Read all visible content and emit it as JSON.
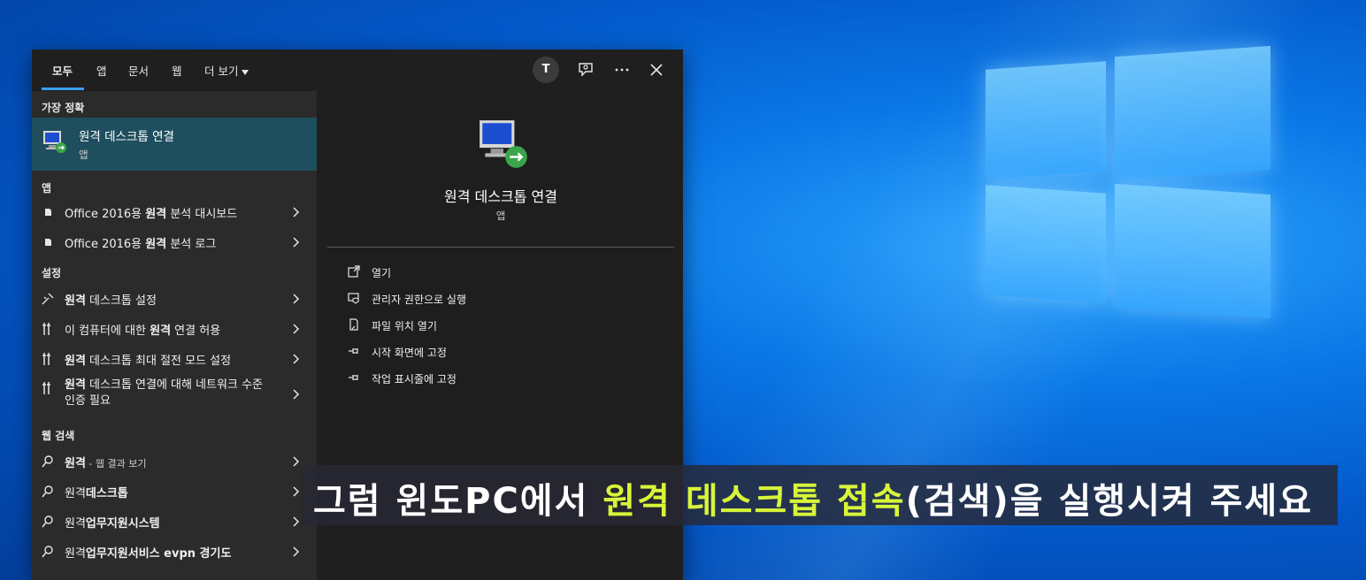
{
  "tabs": [
    {
      "label": "모두",
      "active": true
    },
    {
      "label": "앱"
    },
    {
      "label": "문서"
    },
    {
      "label": "웹"
    },
    {
      "label": "더 보기"
    }
  ],
  "avatar_letter": "T",
  "top_icons": [
    "feedback-icon",
    "more-icon",
    "close-icon"
  ],
  "sections": {
    "best": "가장 정확",
    "apps": "앱",
    "settings": "설정",
    "web": "웹 검색"
  },
  "best_match": {
    "title": "원격 데스크톱 연결",
    "subtitle": "앱",
    "icon": "remote-desktop-icon"
  },
  "apps": [
    {
      "pre": "Office 2016용 ",
      "bold": "원격",
      "post": " 분석 대시보드",
      "icon": "document-icon"
    },
    {
      "pre": "Office 2016용 ",
      "bold": "원격",
      "post": " 분석 로그",
      "icon": "document-icon"
    }
  ],
  "settings": [
    {
      "bold": "원격",
      "post": " 데스크톱 설정",
      "icon": "remote-settings-icon"
    },
    {
      "pre": "이 컴퓨터에 대한 ",
      "bold": "원격",
      "post": " 연결 허용",
      "icon": "tools-icon"
    },
    {
      "bold": "원격",
      "post": " 데스크톱 최대 절전 모드 설정",
      "icon": "tools-icon"
    },
    {
      "bold": "원격",
      "post": " 데스크톱 연결에 대해 네트워크 수준 인증 필요",
      "icon": "tools-icon"
    }
  ],
  "web": [
    {
      "bold": "원격",
      "post": " - 웹 결과 보기",
      "icon": "search-icon"
    },
    {
      "pre": "원격",
      "bold": "데스크톱",
      "icon": "search-icon"
    },
    {
      "pre": "원격",
      "bold": "업무지원시스템",
      "icon": "search-icon"
    },
    {
      "pre": "원격",
      "bold": "업무지원서비스 evpn 경기도",
      "icon": "search-icon"
    }
  ],
  "detail": {
    "title": "원격 데스크톱 연결",
    "subtitle": "앱",
    "actions": [
      {
        "label": "열기",
        "icon": "open-icon"
      },
      {
        "label": "관리자 권한으로 실행",
        "icon": "admin-shield-icon"
      },
      {
        "label": "파일 위치 열기",
        "icon": "file-location-icon"
      },
      {
        "label": "시작 화면에 고정",
        "icon": "pin-icon"
      },
      {
        "label": "작업 표시줄에 고정",
        "icon": "pin-icon"
      }
    ]
  },
  "caption": {
    "part1": "그럼 윈도PC에서 ",
    "highlight1": "원격 데스크톱 접속",
    "part2": "(검색)을 실행시켜 주세요",
    "highlight_color": "#d8f53a"
  }
}
